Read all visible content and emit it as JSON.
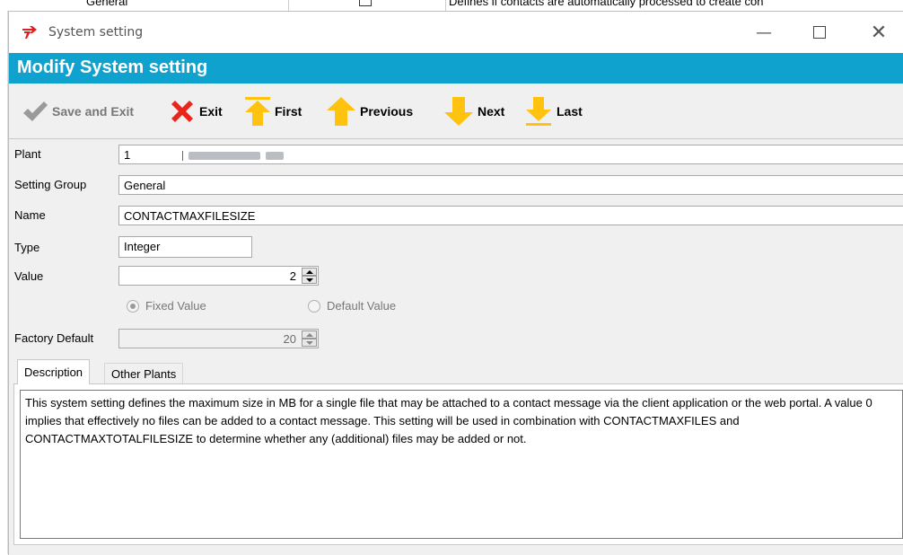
{
  "background": {
    "text_left": "General",
    "text_right": "Defines if contacts are automatically processed to create con"
  },
  "window": {
    "title": "System setting",
    "controls": {
      "minimize": "—",
      "close": "✕"
    }
  },
  "header": {
    "title": "Modify System setting"
  },
  "toolbar": {
    "save_exit": "Save and Exit",
    "exit": "Exit",
    "first": "First",
    "previous": "Previous",
    "next": "Next",
    "last": "Last"
  },
  "form": {
    "plant_label": "Plant",
    "plant_value": "1",
    "setting_group_label": "Setting Group",
    "setting_group_value": "General",
    "name_label": "Name",
    "name_value": "CONTACTMAXFILESIZE",
    "type_label": "Type",
    "type_value": "Integer",
    "value_label": "Value",
    "value_value": "2",
    "fixed_value_label": "Fixed Value",
    "default_value_label": "Default Value",
    "factory_default_label": "Factory Default",
    "factory_default_value": "20"
  },
  "tabs": {
    "description": "Description",
    "other_plants": "Other Plants"
  },
  "description_text": "This system setting defines the maximum size in MB for a single file that may be attached to a contact message via the client application or the web portal. A value 0 implies that effectively no files can be added to a contact message. This setting will be used in combination with CONTACTMAXFILES and CONTACTMAXTOTALFILESIZE to determine whether any (additional) files may be added or not.",
  "colors": {
    "header_bg": "#0fa2cf",
    "arrow_yellow": "#ffc20e",
    "exit_red": "#e8261c",
    "check_gray": "#9a9a9a"
  },
  "icons": {
    "app": "red-logo-icon",
    "save_exit": "checkmark-icon",
    "exit": "red-x-icon",
    "first": "arrow-up-bar-icon",
    "previous": "arrow-up-icon",
    "next": "arrow-down-icon",
    "last": "arrow-down-bar-icon"
  }
}
